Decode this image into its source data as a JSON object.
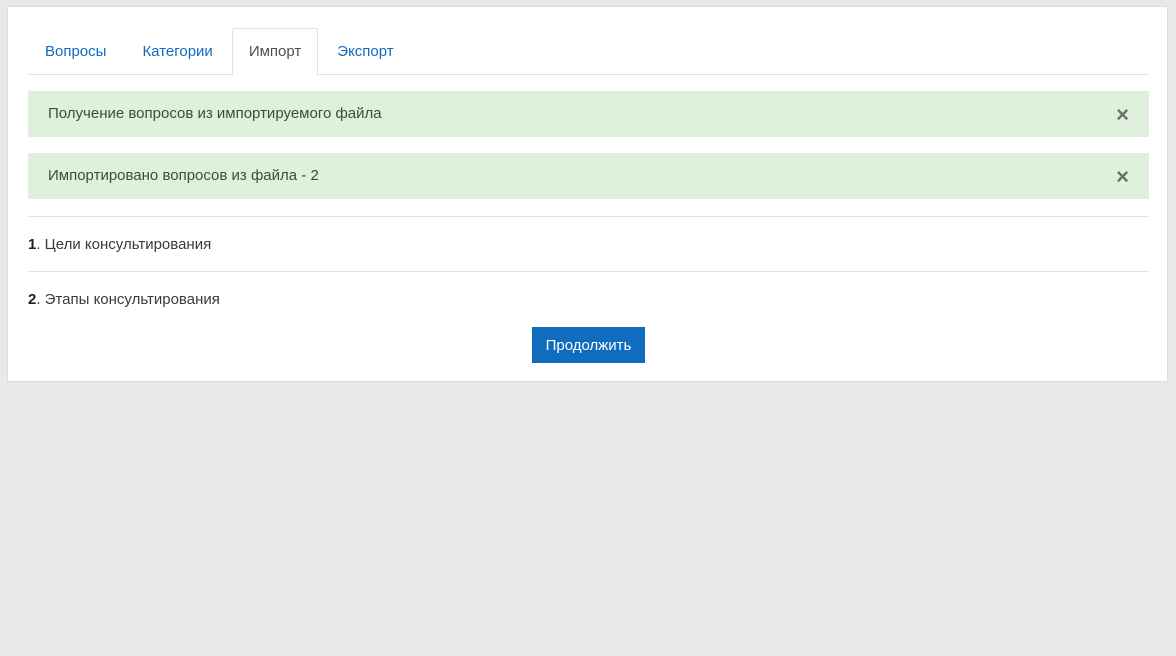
{
  "tabs": [
    {
      "label": "Вопросы",
      "active": false
    },
    {
      "label": "Категории",
      "active": false
    },
    {
      "label": "Импорт",
      "active": true
    },
    {
      "label": "Экспорт",
      "active": false
    }
  ],
  "alerts": [
    {
      "text": "Получение вопросов из импортируемого файла",
      "close": "×"
    },
    {
      "text": "Импортировано вопросов из файла - 2",
      "close": "×"
    }
  ],
  "questions": [
    {
      "number": "1",
      "text": ". Цели консультирования"
    },
    {
      "number": "2",
      "text": ". Этапы консультирования"
    }
  ],
  "continue_button": "Продолжить",
  "colors": {
    "accent": "#0f6cbf",
    "alert_bg": "#dff0dc",
    "page_bg": "#e9e9e9"
  }
}
